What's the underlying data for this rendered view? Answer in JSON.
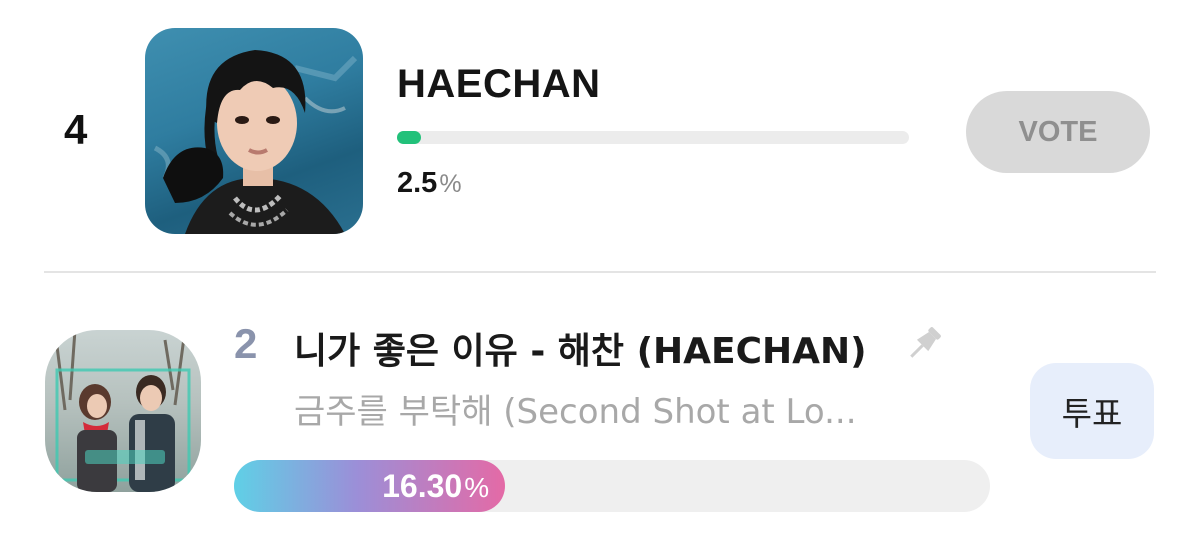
{
  "entry_top": {
    "rank": "4",
    "name": "HAECHAN",
    "progress_fraction": 0.025,
    "percent_value": "2.5",
    "percent_unit": "%",
    "vote_label": "VOTE",
    "bar_color": "#22c17a",
    "icon": "artist-photo"
  },
  "entry_bottom": {
    "rank": "2",
    "title": "니가 좋은 이유 - 해찬 (HAECHAN)",
    "subtitle": "금주를 부탁해 (Second Shot at Lo...",
    "pin_icon": "pin-icon",
    "vote_label": "투표",
    "progress_fraction": 0.163,
    "percent_value": "16.30",
    "percent_unit": "%",
    "bar_gradient": [
      "#5fd0e6",
      "#9b8fd8",
      "#e46aa6"
    ],
    "icon": "album-cover"
  }
}
